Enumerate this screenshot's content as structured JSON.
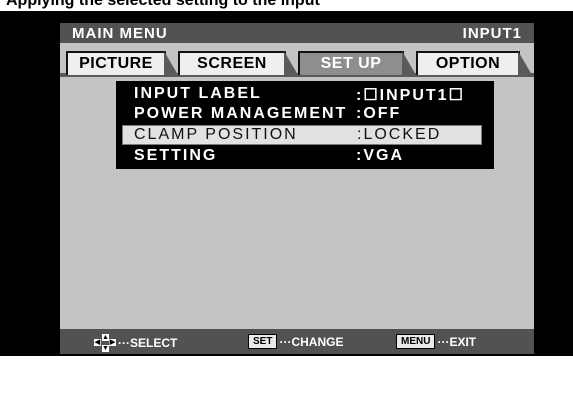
{
  "top_text": "Applying the selected setting to the input",
  "header": {
    "title": "MAIN MENU",
    "input": "INPUT1"
  },
  "tabs": [
    {
      "label": "PICTURE",
      "active": false
    },
    {
      "label": "SCREEN",
      "active": false
    },
    {
      "label": "SET UP",
      "active": true
    },
    {
      "label": "OPTION",
      "active": false
    }
  ],
  "menu": {
    "items": [
      {
        "label": "INPUT LABEL",
        "value": ":☐INPUT1☐"
      },
      {
        "label": "POWER MANAGEMENT",
        "value": ":OFF"
      },
      {
        "label": "CLAMP POSITION",
        "value": ":LOCKED",
        "selected": true
      },
      {
        "label": "SETTING",
        "value": ":VGA"
      }
    ]
  },
  "footer": {
    "select_text": "···SELECT",
    "set_key": "SET",
    "change_text": "···CHANGE",
    "menu_key": "MENU",
    "exit_text": "···EXIT"
  },
  "colors": {
    "panel": "#c4c4c4",
    "header": "#525252",
    "menu_box": "#000000",
    "selected_row": "#e2e2e2"
  }
}
